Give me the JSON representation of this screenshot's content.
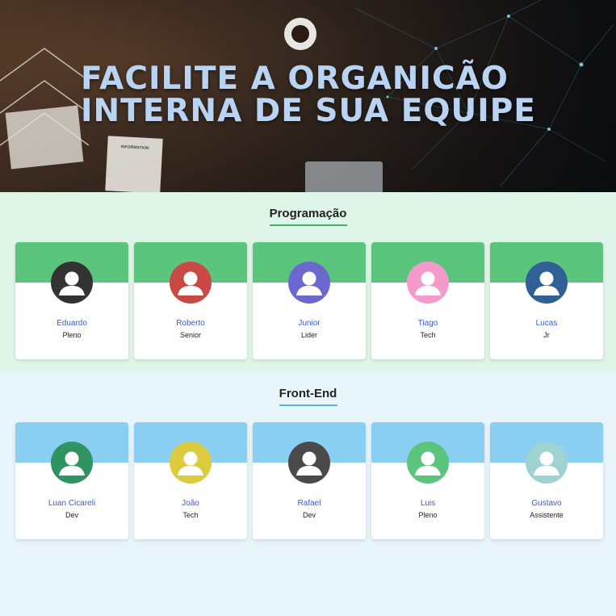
{
  "hero": {
    "title_line1": "FACILITE A ORGANICÃO",
    "title_line2": "INTERNA DE SUA EQUIPE",
    "paper_label": "INFORMATION"
  },
  "colors": {
    "green_band": "#5cc57d",
    "blue_band": "#8acff2",
    "green_line": "#3db46d",
    "blue_line": "#55b6e4",
    "name_text": "#3b5bc4"
  },
  "sections": [
    {
      "title": "Programação",
      "band": "green",
      "members": [
        {
          "name": "Eduardo",
          "role": "Pleno",
          "avatar_color": "#333333"
        },
        {
          "name": "Roberto",
          "role": "Senior",
          "avatar_color": "#c94a45"
        },
        {
          "name": "Junior",
          "role": "Lider",
          "avatar_color": "#6b68cf"
        },
        {
          "name": "Tiago",
          "role": "Tech",
          "avatar_color": "#f59bcb"
        },
        {
          "name": "Lucas",
          "role": "Jr",
          "avatar_color": "#2f6196"
        }
      ]
    },
    {
      "title": "Front-End",
      "band": "blue",
      "members": [
        {
          "name": "Luan Cicareli",
          "role": "Dev",
          "avatar_color": "#2f9462"
        },
        {
          "name": "João",
          "role": "Tech",
          "avatar_color": "#dccb3c"
        },
        {
          "name": "Rafael",
          "role": "Dev",
          "avatar_color": "#4a4a4a"
        },
        {
          "name": "Luis",
          "role": "Pleno",
          "avatar_color": "#5cc57d"
        },
        {
          "name": "Gustavo",
          "role": "Assistente",
          "avatar_color": "#9fd3d3"
        }
      ]
    }
  ]
}
